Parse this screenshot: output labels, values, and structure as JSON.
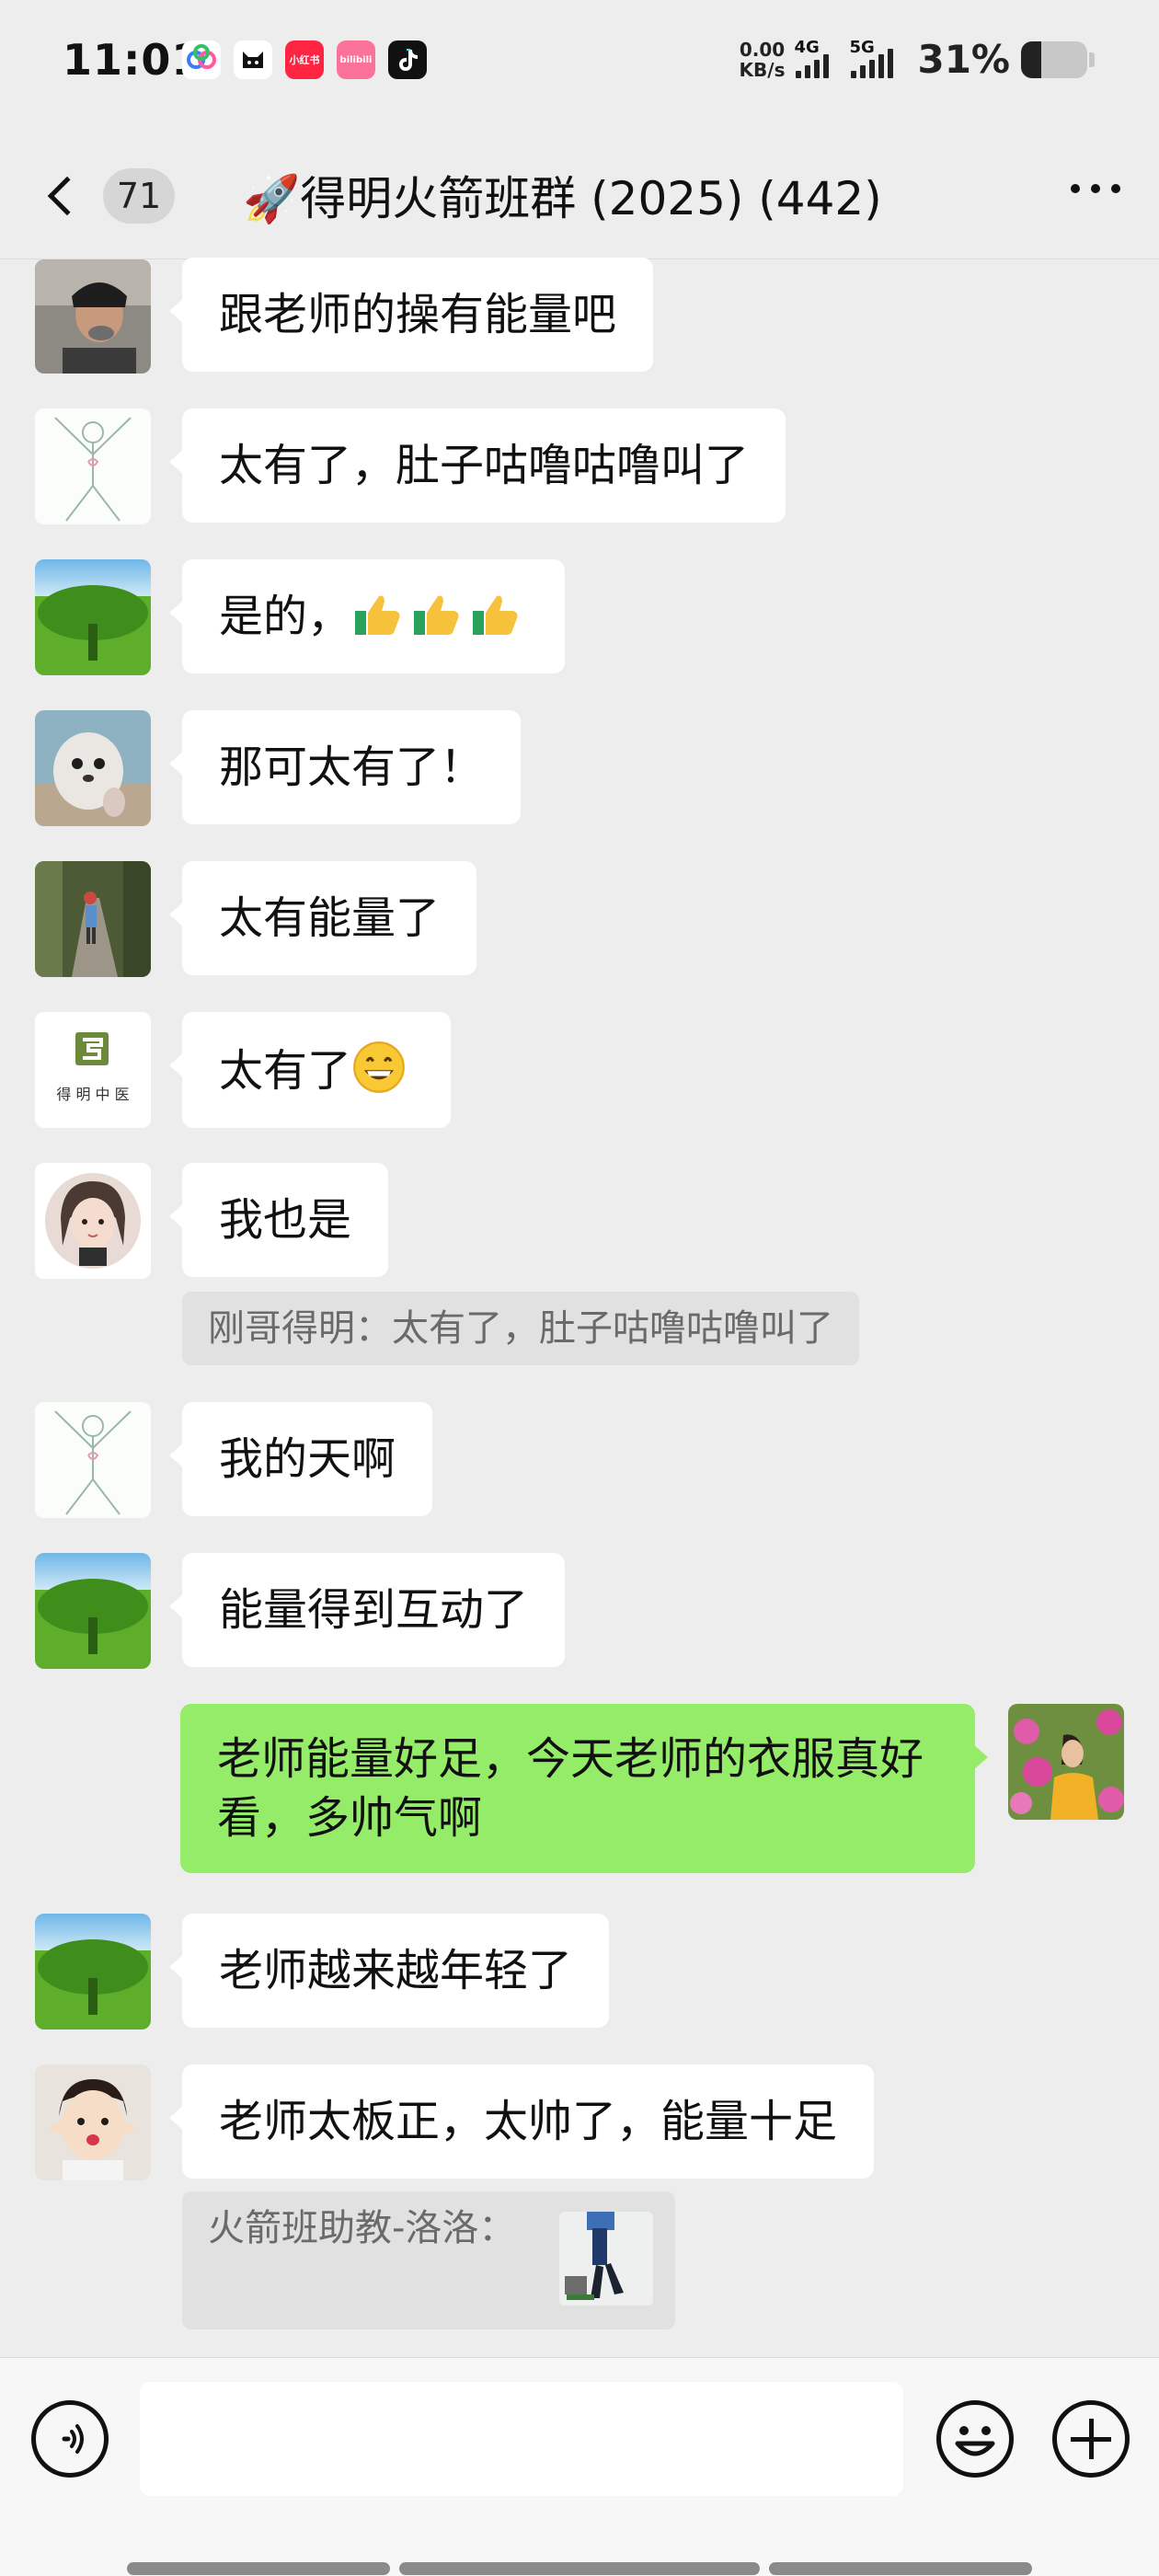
{
  "status_bar": {
    "time": "11:01",
    "net_speed_value": "0.00",
    "net_speed_unit": "KB/s",
    "signal_1": "4G",
    "signal_2": "5G",
    "battery": "31%",
    "battery_level": 0.31,
    "apps": [
      "小红书",
      "bilibili"
    ]
  },
  "nav": {
    "unread_count": "71",
    "title": "🚀得明火箭班群 (2025) (442)"
  },
  "messages": [
    {
      "text": "跟老师的操有能量吧"
    },
    {
      "text": "太有了，肚子咕噜咕噜叫了"
    },
    {
      "text": "是的，"
    },
    {
      "text": "那可太有了！"
    },
    {
      "text": "太有能量了"
    },
    {
      "text": "太有了"
    },
    {
      "text": "我也是",
      "quote": "刚哥得明：太有了，肚子咕噜咕噜叫了"
    },
    {
      "text": "我的天啊"
    },
    {
      "text": "能量得到互动了"
    },
    {
      "text": "老师能量好足，今天老师的衣服真好看，多帅气啊",
      "self": true
    },
    {
      "text": "老师越来越年轻了"
    },
    {
      "text": "老师太板正，太帅了，能量十足",
      "quote": "火箭班助教-洛洛："
    }
  ],
  "avatar_logo_text": "得 明 中 医",
  "colors": {
    "background": "#ededed",
    "self_bubble": "#95ec69",
    "other_bubble": "#ffffff",
    "quote_bg": "#e1e1e1"
  },
  "icons": [
    "back-chevron-icon",
    "more-icon",
    "voice-icon",
    "emoji-icon",
    "plus-icon",
    "thumbs-up-icon",
    "grin-emoji-icon"
  ]
}
